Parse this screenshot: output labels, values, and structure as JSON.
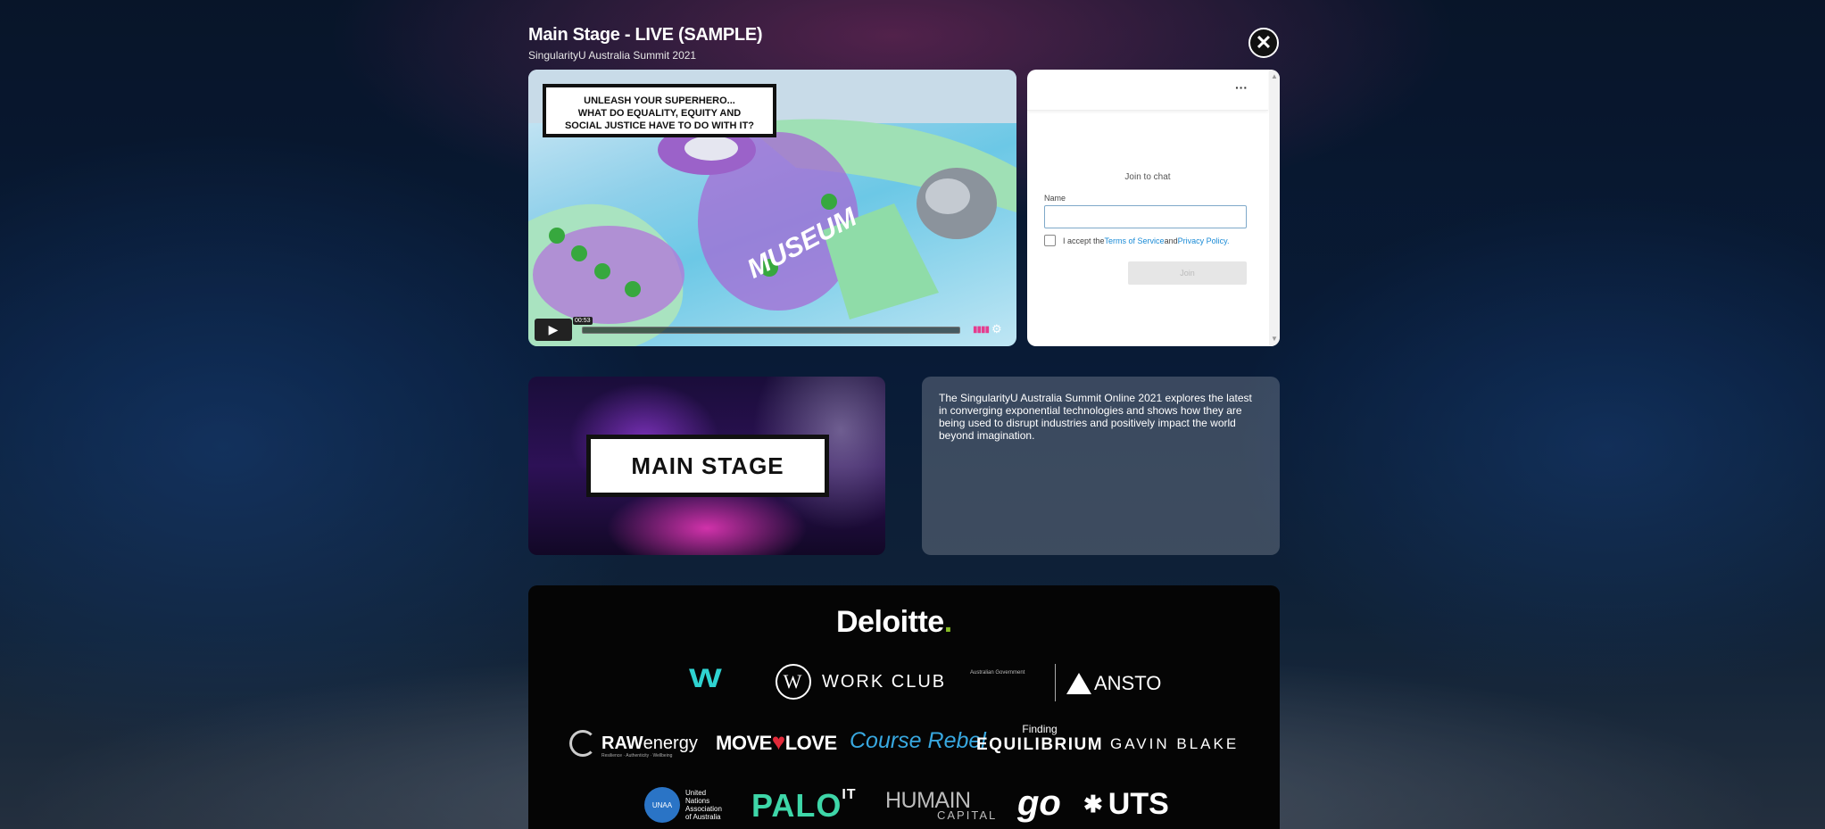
{
  "header": {
    "title": "Main Stage - LIVE (SAMPLE)",
    "subtitle": "SingularityU Australia Summit 2021",
    "close_icon": "✕"
  },
  "video": {
    "comic_caption_lines": [
      "UNLEASH YOUR SUPERHERO...",
      "WHAT DO EQUALITY, EQUITY AND",
      "SOCIAL JUSTICE HAVE TO DO WITH IT?"
    ],
    "building_sign": "MUSEUM",
    "timestamp": "00:53",
    "play_icon": "▶",
    "volume_icon": "▮▮▮▮",
    "settings_icon": "⚙",
    "progress": 0.0
  },
  "chat": {
    "menu_icon": "···",
    "join_title": "Join to chat",
    "name_label": "Name",
    "name_value": "",
    "accept_prefix": "I accept the ",
    "terms_link": "Terms of Service",
    "accept_and": " and ",
    "privacy_link": "Privacy Policy.",
    "join_button": "Join",
    "scroll_up_icon": "▲",
    "scroll_down_icon": "▼"
  },
  "banner": {
    "label": "MAIN STAGE"
  },
  "description": {
    "text": "The SingularityU Australia Summit Online 2021 explores the latest in converging exponential technologies and shows how they are being used to disrupt industries and positively impact the world beyond imagination."
  },
  "sponsors": {
    "deloitte": "Deloitte",
    "deloitte_dot": ".",
    "w_logo": "W",
    "workclub_mark": "W",
    "workclub": "WORK CLUB",
    "crest_text": "Australian Government",
    "ansto": "ANSTO",
    "raw_bold": "RAW",
    "raw_light": "energy",
    "raw_tag": "Resilience · Authenticity · Wellbeing",
    "move": "MOVE",
    "move_heart": "♥",
    "move_love": "LOVE",
    "course_rebel": "Course Rebel",
    "finding": "Finding",
    "equilibrium": "EQUILIBRIUM",
    "gavin_blake": "GAVIN BLAKE",
    "una_mark": "UNAA",
    "una_text_1": "United",
    "una_text_2": "Nations",
    "una_text_3": "Association",
    "una_text_4": "of Australia",
    "palo": "PALO",
    "palo_it": "IT",
    "humain": "HUMAIN",
    "capital": "CAPITAL",
    "go": "go",
    "uts_mark": "✱",
    "uts": "UTS"
  }
}
